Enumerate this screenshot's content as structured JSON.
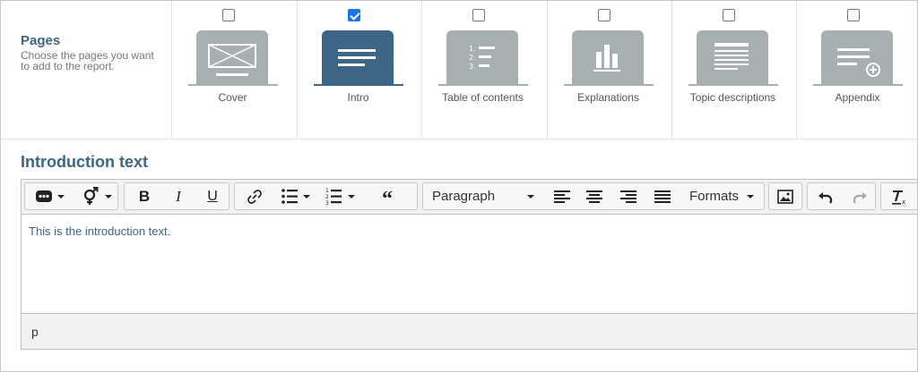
{
  "pages": {
    "title": "Pages",
    "description": "Choose the pages you want to add to the report.",
    "options": [
      {
        "label": "Cover",
        "checked": false,
        "icon": "cover-icon"
      },
      {
        "label": "Intro",
        "checked": true,
        "icon": "intro-icon"
      },
      {
        "label": "Table of contents",
        "checked": false,
        "icon": "toc-icon"
      },
      {
        "label": "Explanations",
        "checked": false,
        "icon": "bar-chart-icon"
      },
      {
        "label": "Topic descriptions",
        "checked": false,
        "icon": "document-icon"
      },
      {
        "label": "Appendix",
        "checked": false,
        "icon": "appendix-icon"
      }
    ]
  },
  "intro": {
    "title": "Introduction text",
    "content": "This is the introduction text.",
    "status_path": "p"
  },
  "toolbar": {
    "block_format": "Paragraph",
    "formats": "Formats"
  },
  "colors": {
    "accent": "#3d6585",
    "thumb": "#a8afb1",
    "checkbox": "#1a73e8"
  }
}
